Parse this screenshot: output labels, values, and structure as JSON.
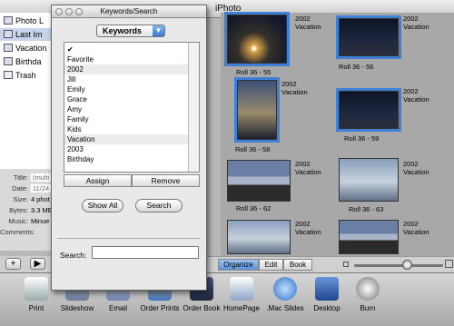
{
  "window": {
    "title": "iPhoto"
  },
  "source_list": [
    {
      "label": "Photo L",
      "icon": "photo-library-icon"
    },
    {
      "label": "Last Im",
      "icon": "last-import-icon"
    },
    {
      "label": "Vacation",
      "icon": "album-icon"
    },
    {
      "label": "Birthda",
      "icon": "album-icon"
    },
    {
      "label": "Trash",
      "icon": "trash-icon"
    }
  ],
  "info": [
    {
      "key": "Title:",
      "value": "(multi"
    },
    {
      "key": "Date:",
      "value": "11/24"
    },
    {
      "key": "Size:",
      "value": "4 phot"
    },
    {
      "key": "Bytes:",
      "value": "3.3 ME"
    },
    {
      "key": "Music:",
      "value": "Minue"
    },
    {
      "key": "Comments:",
      "value": ""
    }
  ],
  "photos": [
    {
      "caption": "Roll 36 - 55",
      "year": "2002",
      "keyword": "Vacation",
      "selected": true
    },
    {
      "caption": "Roll 36 - 56",
      "year": "2002",
      "keyword": "Vacation",
      "selected": true
    },
    {
      "caption": "Roll 36 - 58",
      "year": "2002",
      "keyword": "Vacation",
      "selected": true
    },
    {
      "caption": "Roll 36 - 59",
      "year": "2002",
      "keyword": "Vacation",
      "selected": true
    },
    {
      "caption": "Roll 36 - 62",
      "year": "2002",
      "keyword": "Vacation",
      "selected": false
    },
    {
      "caption": "Roll 36 - 63",
      "year": "2002",
      "keyword": "Vacation",
      "selected": false
    },
    {
      "caption": "",
      "year": "2002",
      "keyword": "Vacation",
      "selected": false
    },
    {
      "caption": "",
      "year": "2002",
      "keyword": "Vacation",
      "selected": false
    }
  ],
  "modes": {
    "organize": "Organize",
    "edit": "Edit",
    "book": "Book",
    "active": "Organize"
  },
  "toolbar": [
    {
      "label": "Print",
      "icon": "printer-icon"
    },
    {
      "label": "Slideshow",
      "icon": "slideshow-icon"
    },
    {
      "label": "Email",
      "icon": "email-icon"
    },
    {
      "label": "Order Prints",
      "icon": "order-prints-icon"
    },
    {
      "label": "Order Book",
      "icon": "order-book-icon"
    },
    {
      "label": "HomePage",
      "icon": "homepage-icon"
    },
    {
      "label": ".Mac Slides",
      "icon": "mac-slides-icon"
    },
    {
      "label": "Desktop",
      "icon": "desktop-icon"
    },
    {
      "label": "Burn",
      "icon": "burn-icon"
    }
  ],
  "palette": {
    "title": "Keywords/Search",
    "popup": "Keywords",
    "checkmark": "✔",
    "keywords": [
      "Favorite",
      "2002",
      "Jill",
      "Emily",
      "Grace",
      "Amy",
      "Family",
      "Kids",
      "Vacation",
      "2003",
      "Birthday"
    ],
    "assign": "Assign",
    "remove": "Remove",
    "show_all": "Show All",
    "search": "Search",
    "search_label": "Search:",
    "search_value": ""
  },
  "colors": {
    "selection": "#3f7fd6",
    "active_mode": "#5d92d8"
  }
}
